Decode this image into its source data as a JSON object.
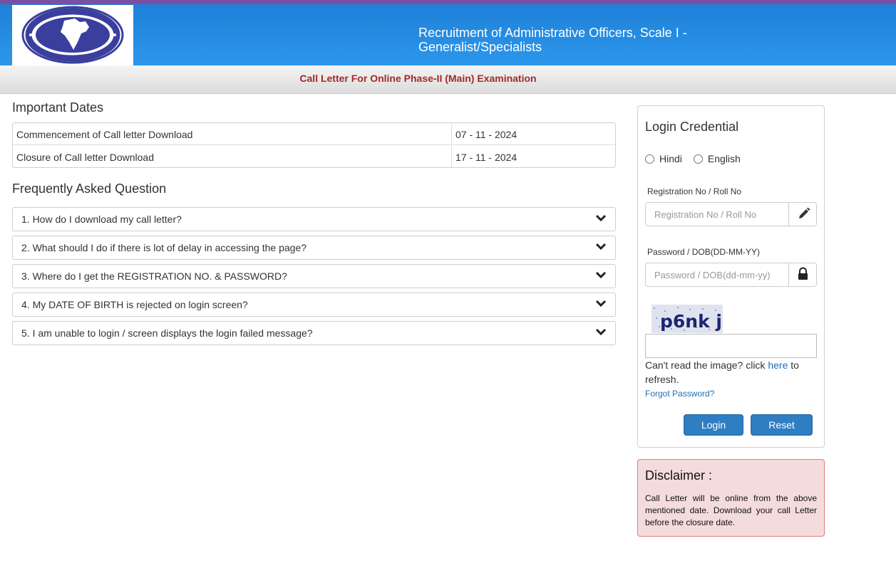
{
  "header": {
    "title": "Recruitment of Administrative Officers, Scale I - Generalist/Specialists",
    "logo_icon": "new-india-assurance-logo"
  },
  "subheader": {
    "text": "Call Letter For Online Phase-II (Main) Examination"
  },
  "important_dates": {
    "title": "Important Dates",
    "rows": [
      {
        "label": "Commencement of Call letter Download",
        "value": "07 - 11 - 2024"
      },
      {
        "label": "Closure of Call letter Download",
        "value": "17 - 11 - 2024"
      }
    ]
  },
  "faq": {
    "title": "Frequently Asked Question",
    "items": [
      "1. How do I download my call letter?",
      "2. What should I do if there is lot of delay in accessing the page?",
      "3. Where do I get the REGISTRATION NO. & PASSWORD?",
      "4. My DATE OF BIRTH is rejected on login screen?",
      "5. I am unable to login / screen displays the login failed message?"
    ]
  },
  "login": {
    "title": "Login Credential",
    "languages": [
      "Hindi",
      "English"
    ],
    "reg_label": "Registration No / Roll No",
    "reg_placeholder": "Registration No / Roll No",
    "pwd_label": "Password / DOB(DD-MM-YY)",
    "pwd_placeholder": "Password / DOB(dd-mm-yy)",
    "captcha_text": "p6nk j",
    "refresh_before": "Can't read the image? click ",
    "refresh_link": "here",
    "refresh_after": " to refresh.",
    "forgot": "Forgot Password?",
    "login_button": "Login",
    "reset_button": "Reset"
  },
  "disclaimer": {
    "title": "Disclaimer :",
    "text": "Call Letter will be online from the above mentioned date. Download your call Letter before the closure date."
  },
  "colors": {
    "header_blue": "#2c97ec",
    "top_strip": "#7a4fa3",
    "subheader_text": "#a5282d",
    "button": "#2f7dc3",
    "disclaimer_bg": "#f4dcdc"
  }
}
